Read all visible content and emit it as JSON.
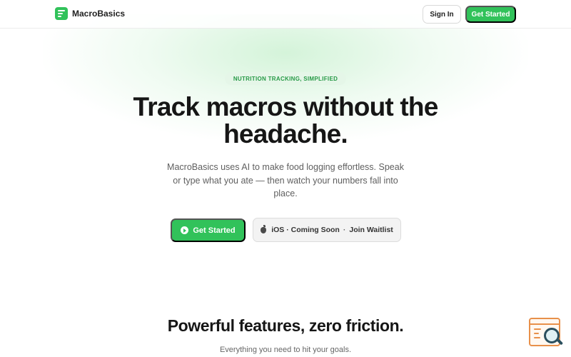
{
  "nav": {
    "brand": "MacroBasics",
    "sign_in": "Sign In",
    "get_started": "Get Started"
  },
  "hero": {
    "badge": "NUTRITION TRACKING, SIMPLIFIED",
    "headline": "Track macros without the headache.",
    "subtext": "MacroBasics uses AI to make food logging effortless. Speak or type what you ate — then watch your numbers fall into place.",
    "primary_cta": "Get Started",
    "waitlist_cta": {
      "platform": "iOS · Coming Soon",
      "separator": "·",
      "action": "Join Waitlist"
    }
  },
  "features": {
    "title": "Powerful features, zero friction.",
    "subtitle": "Everything you need to hit your goals."
  },
  "icons": {
    "brand": "list-lines-icon",
    "primary_cta": "play-circle-icon",
    "waitlist": "apple-icon",
    "floating_widget": "search-window-icon"
  },
  "colors": {
    "accent": "#31c25a",
    "badge_bg": "#e5f6e8",
    "badge_text": "#279a47",
    "widget_orange": "#e8904a",
    "widget_teal": "#2a4f5e"
  }
}
